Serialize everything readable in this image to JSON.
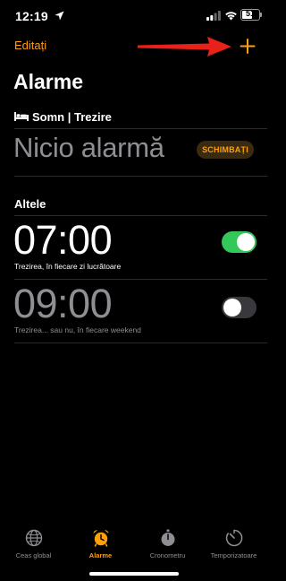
{
  "status_bar": {
    "time": "12:19",
    "battery": "51"
  },
  "nav": {
    "edit_label": "Editați"
  },
  "page": {
    "title": "Alarme"
  },
  "sleep": {
    "header": "Somn | Trezire",
    "no_alarm": "Nicio alarmă",
    "change_label": "SCHIMBAȚI"
  },
  "other": {
    "header": "Altele"
  },
  "alarms": [
    {
      "time": "07:00",
      "label": "Trezirea, în fiecare zi lucrătoare",
      "enabled": true
    },
    {
      "time": "09:00",
      "label": "Trezirea... sau nu, în fiecare weekend",
      "enabled": false
    }
  ],
  "tabs": [
    {
      "label": "Ceas global",
      "icon": "globe-icon",
      "active": false
    },
    {
      "label": "Alarme",
      "icon": "alarm-clock-icon",
      "active": true
    },
    {
      "label": "Cronometru",
      "icon": "stopwatch-icon",
      "active": false
    },
    {
      "label": "Temporizatoare",
      "icon": "timer-icon",
      "active": false
    }
  ],
  "colors": {
    "accent": "#ff9f0a",
    "toggle_on": "#34c759",
    "toggle_off": "#39393d",
    "annotation_arrow": "#e8221a"
  }
}
